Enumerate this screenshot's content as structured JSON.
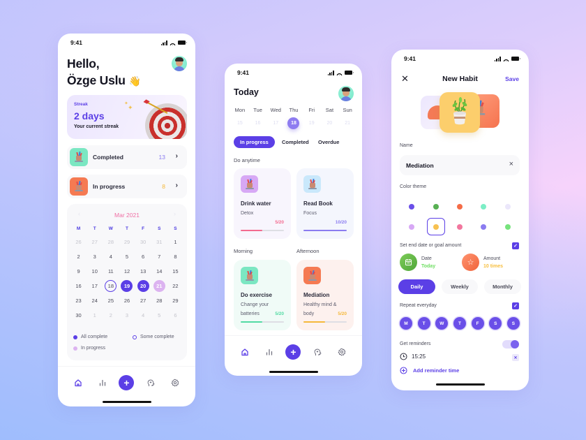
{
  "theme": {
    "accent": "#5b3fe6",
    "green": "#3ccf8e",
    "orange": "#f57148",
    "pink": "#ef6ea4",
    "yellow": "#f5b93b"
  },
  "status_bar": {
    "time": "9:41"
  },
  "home": {
    "greeting_line1": "Hello,",
    "greeting_line2": "Özge Uslu",
    "wave_emoji": "👋",
    "streak": {
      "label": "Streak",
      "value": "2 days",
      "caption": "Your current streak"
    },
    "summary": [
      {
        "label": "Completed",
        "count": "13",
        "count_color": "#8b7cf0",
        "icon": "pencil-cup-icon",
        "icon_bg": "#7be7c2"
      },
      {
        "label": "In progress",
        "count": "8",
        "count_color": "#f5b93b",
        "icon": "pencil-cup-icon",
        "icon_bg": "#f57a52"
      }
    ],
    "calendar": {
      "month": "Mar 2021",
      "weekdays": [
        "M",
        "T",
        "W",
        "T",
        "F",
        "S",
        "S"
      ],
      "days": [
        {
          "n": "26",
          "s": "out"
        },
        {
          "n": "27",
          "s": "out"
        },
        {
          "n": "28",
          "s": "out"
        },
        {
          "n": "29",
          "s": "out"
        },
        {
          "n": "30",
          "s": "out"
        },
        {
          "n": "31",
          "s": "out"
        },
        {
          "n": "1",
          "s": ""
        },
        {
          "n": "2",
          "s": ""
        },
        {
          "n": "3",
          "s": ""
        },
        {
          "n": "4",
          "s": ""
        },
        {
          "n": "5",
          "s": ""
        },
        {
          "n": "6",
          "s": ""
        },
        {
          "n": "7",
          "s": ""
        },
        {
          "n": "8",
          "s": ""
        },
        {
          "n": "9",
          "s": ""
        },
        {
          "n": "10",
          "s": ""
        },
        {
          "n": "11",
          "s": ""
        },
        {
          "n": "12",
          "s": ""
        },
        {
          "n": "13",
          "s": ""
        },
        {
          "n": "14",
          "s": ""
        },
        {
          "n": "15",
          "s": ""
        },
        {
          "n": "16",
          "s": ""
        },
        {
          "n": "17",
          "s": ""
        },
        {
          "n": "18",
          "s": "some"
        },
        {
          "n": "19",
          "s": "all"
        },
        {
          "n": "20",
          "s": "all"
        },
        {
          "n": "21",
          "s": "prog"
        },
        {
          "n": "22",
          "s": ""
        },
        {
          "n": "23",
          "s": ""
        },
        {
          "n": "24",
          "s": ""
        },
        {
          "n": "25",
          "s": ""
        },
        {
          "n": "26",
          "s": ""
        },
        {
          "n": "27",
          "s": ""
        },
        {
          "n": "28",
          "s": ""
        },
        {
          "n": "29",
          "s": ""
        },
        {
          "n": "30",
          "s": ""
        },
        {
          "n": "1",
          "s": "out"
        },
        {
          "n": "2",
          "s": "out"
        },
        {
          "n": "3",
          "s": "out"
        },
        {
          "n": "4",
          "s": "out"
        },
        {
          "n": "5",
          "s": "out"
        },
        {
          "n": "6",
          "s": "out"
        }
      ],
      "legend": {
        "all": "All complete",
        "some": "Some complete",
        "progress": "In progress"
      }
    }
  },
  "tabbar": {
    "items": [
      "home",
      "stats",
      "add",
      "mind",
      "settings"
    ],
    "active": "home",
    "add_label": "+"
  },
  "today": {
    "title": "Today",
    "week": [
      {
        "d": "Mon",
        "n": "15"
      },
      {
        "d": "Tue",
        "n": "16"
      },
      {
        "d": "Wed",
        "n": "17"
      },
      {
        "d": "Thu",
        "n": "18",
        "selected": true
      },
      {
        "d": "Fri",
        "n": "19"
      },
      {
        "d": "Sat",
        "n": "20"
      },
      {
        "d": "Sun",
        "n": "21"
      }
    ],
    "filters": [
      "In progress",
      "Completed",
      "Overdue"
    ],
    "active_filter": "In progress",
    "sections": {
      "anytime": "Do anytime",
      "morning": "Morning",
      "afternoon": "Afternoon"
    },
    "habits": [
      {
        "title": "Drink water",
        "subtitle": "Detox",
        "done": 5,
        "goal": 20,
        "ratio": "5/20",
        "color": "#f36b8f",
        "card_bg": "#f8f5fd",
        "icon_bg": "#d7a8f5"
      },
      {
        "title": "Read Book",
        "subtitle": "Focus",
        "done": 10,
        "goal": 20,
        "ratio": "10/20",
        "color": "#8b7cf0",
        "card_bg": "#f4f6fd",
        "icon_bg": "#c9e8fb"
      },
      {
        "title": "Do exercise",
        "subtitle": "Change your batteries",
        "done": 5,
        "goal": 20,
        "ratio": "5/20",
        "color": "#52dba3",
        "card_bg": "#f0fbf7",
        "icon_bg": "#7be7c2"
      },
      {
        "title": "Mediation",
        "subtitle": "Healthy mind & body",
        "done": 5,
        "goal": 20,
        "ratio": "5/20",
        "color": "#f5b93b",
        "card_bg": "#fdf1ee",
        "icon_bg": "#f57a52"
      }
    ]
  },
  "new_habit": {
    "title": "New Habit",
    "close_label": "✕",
    "save_label": "Save",
    "name_label": "Name",
    "name_value": "Mediation",
    "color_theme_label": "Color theme",
    "colors": [
      "#6a4fe8",
      "#58b053",
      "#f56c47",
      "#7ceec6",
      "#ebe7fb",
      "#d7a8f5",
      "#f7c150",
      "#f2779e",
      "#8b7cf0",
      "#77e37d"
    ],
    "selected_color": 6,
    "goal_toggle_label": "Set end date or goal amount",
    "goal_checked": true,
    "date": {
      "label": "Date",
      "value": "Today"
    },
    "amount": {
      "label": "Amount",
      "value": "10 times"
    },
    "frequency": [
      "Daily",
      "Weekly",
      "Monthly"
    ],
    "active_frequency": "Daily",
    "repeat_label": "Repeat everyday",
    "repeat_checked": true,
    "repeat_days": [
      "M",
      "T",
      "W",
      "T",
      "F",
      "S",
      "S"
    ],
    "reminders_label": "Get reminders",
    "reminders_on": true,
    "reminder_time": "15:25",
    "add_reminder_label": "Add reminder time"
  }
}
